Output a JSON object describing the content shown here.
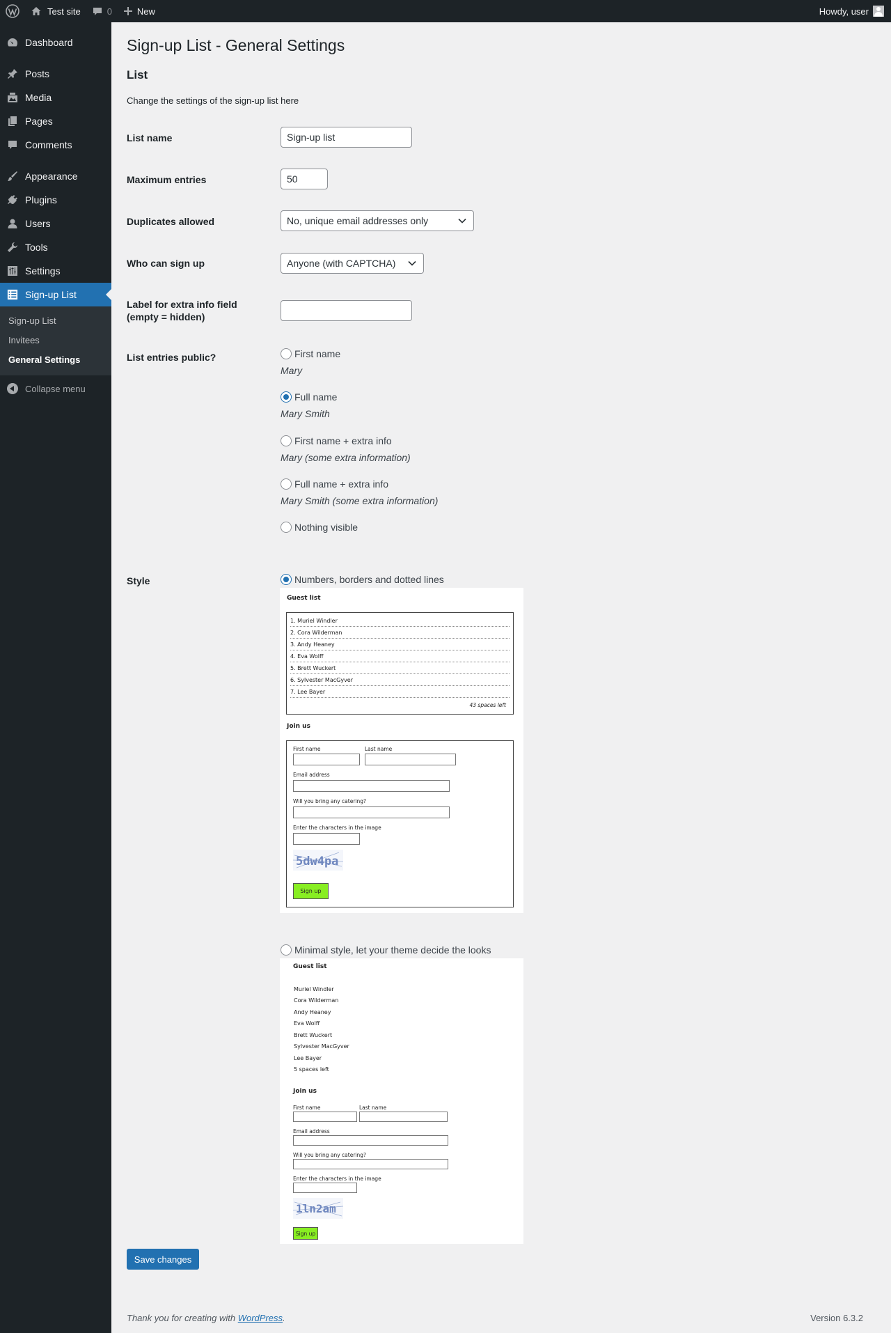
{
  "adminbar": {
    "site_name": "Test site",
    "comments_count": "0",
    "new_label": "New",
    "greeting": "Howdy, user"
  },
  "sidebar": {
    "items": [
      {
        "label": "Dashboard",
        "icon": "dashboard-icon"
      },
      {
        "label": "Posts",
        "icon": "pin-icon"
      },
      {
        "label": "Media",
        "icon": "media-icon"
      },
      {
        "label": "Pages",
        "icon": "pages-icon"
      },
      {
        "label": "Comments",
        "icon": "comment-icon"
      },
      {
        "label": "Appearance",
        "icon": "brush-icon"
      },
      {
        "label": "Plugins",
        "icon": "plug-icon"
      },
      {
        "label": "Users",
        "icon": "user-icon"
      },
      {
        "label": "Tools",
        "icon": "wrench-icon"
      },
      {
        "label": "Settings",
        "icon": "settings-icon"
      },
      {
        "label": "Sign-up List",
        "icon": "list-icon"
      }
    ],
    "submenu": [
      "Sign-up List",
      "Invitees",
      "General Settings"
    ],
    "collapse_label": "Collapse menu",
    "accent_color": "#2271b1"
  },
  "page": {
    "title": "Sign-up List - General Settings",
    "section_title": "List",
    "section_desc": "Change the settings of the sign-up list here"
  },
  "form": {
    "list_name": {
      "label": "List name",
      "value": "Sign-up list"
    },
    "max_entries": {
      "label": "Maximum entries",
      "value": "50"
    },
    "duplicates": {
      "label": "Duplicates allowed",
      "value": "No, unique email addresses only"
    },
    "who": {
      "label": "Who can sign up",
      "value": "Anyone (with CAPTCHA)"
    },
    "extra_label": {
      "label_line1": "Label for extra info field",
      "label_line2": "(empty = hidden)",
      "value": ""
    },
    "public": {
      "label": "List entries public?",
      "options": [
        {
          "label": "First name",
          "example": "Mary",
          "checked": false
        },
        {
          "label": "Full name",
          "example": "Mary Smith",
          "checked": true
        },
        {
          "label": "First name + extra info",
          "example": "Mary (some extra information)",
          "checked": false
        },
        {
          "label": "Full name + extra info",
          "example": "Mary Smith (some extra information)",
          "checked": false
        },
        {
          "label": "Nothing visible",
          "example": "",
          "checked": false
        }
      ]
    },
    "style": {
      "label": "Style",
      "options": [
        {
          "label": "Numbers, borders and dotted lines",
          "checked": true
        },
        {
          "label": "Minimal style, let your theme decide the looks",
          "checked": false
        }
      ]
    },
    "save_label": "Save changes"
  },
  "preview": {
    "guest_heading": "Guest list",
    "join_heading": "Join us",
    "guests_numbered": [
      "1. Muriel Windler",
      "2. Cora Wilderman",
      "3. Andy Heaney",
      "4. Eva Wolff",
      "5. Brett Wuckert",
      "6. Sylvester MacGyver",
      "7. Lee Bayer"
    ],
    "guests_plain": [
      "Muriel Windler",
      "Cora Wilderman",
      "Andy Heaney",
      "Eva Wolff",
      "Brett Wuckert",
      "Sylvester MacGyver",
      "Lee Bayer"
    ],
    "spaces_left_1": "43 spaces left",
    "spaces_left_2": "5 spaces left",
    "first_name": "First name",
    "last_name": "Last name",
    "email": "Email address",
    "catering": "Will you bring any catering?",
    "captcha_prompt": "Enter the characters in the image",
    "captcha_1": "5dw4pa",
    "captcha_2": "1ln2am",
    "signup_button": "Sign up",
    "button_color": "#88ee22"
  },
  "footer": {
    "thanks_prefix": "Thank you for creating with ",
    "thanks_link": "WordPress",
    "thanks_suffix": ".",
    "version": "Version 6.3.2"
  }
}
